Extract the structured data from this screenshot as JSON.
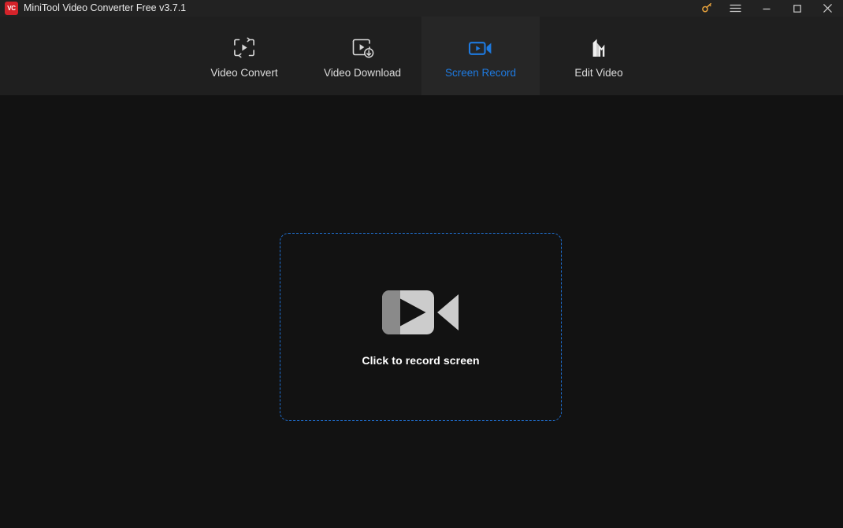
{
  "window": {
    "title": "MiniTool Video Converter Free v3.7.1",
    "logo_text": "VC",
    "logo_color": "#d4232a",
    "controls": [
      {
        "name": "license-key",
        "icon": "key-icon",
        "color": "#e8a33d"
      },
      {
        "name": "menu",
        "icon": "hamburger-menu-icon",
        "color": "#d0d0d0"
      },
      {
        "name": "minimize",
        "icon": "minimize-icon",
        "color": "#d0d0d0"
      },
      {
        "name": "maximize",
        "icon": "maximize-icon",
        "color": "#d0d0d0"
      },
      {
        "name": "close",
        "icon": "close-icon",
        "color": "#d0d0d0"
      }
    ]
  },
  "nav": {
    "active_color": "#1e7ae0",
    "tabs": [
      {
        "label": "Video Convert",
        "icon": "video-convert-icon",
        "active": false
      },
      {
        "label": "Video Download",
        "icon": "video-download-icon",
        "active": false
      },
      {
        "label": "Screen Record",
        "icon": "screen-record-icon",
        "active": true
      },
      {
        "label": "Edit Video",
        "icon": "edit-video-icon",
        "active": false
      }
    ]
  },
  "main": {
    "dropzone": {
      "label": "Click to record screen",
      "icon": "camcorder-icon",
      "border_color": "#1f6fd0",
      "border_style": "dashed"
    }
  },
  "colors": {
    "titlebar_bg": "#222222",
    "header_bg": "#1f1f1f",
    "active_tab_bg": "#262626",
    "body_bg": "#121212",
    "accent": "#1e7ae0",
    "text": "#e8e8e8"
  }
}
